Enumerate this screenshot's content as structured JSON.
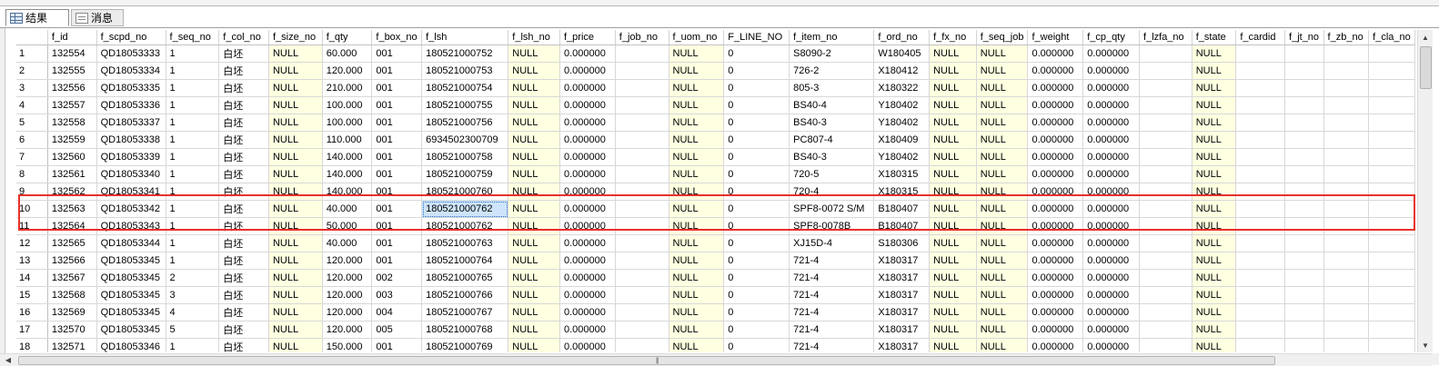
{
  "tabs": [
    {
      "label": "结果",
      "icon": "results-grid-icon",
      "active": true
    },
    {
      "label": "消息",
      "icon": "messages-icon",
      "active": false
    }
  ],
  "columns": [
    "f_id",
    "f_scpd_no",
    "f_seq_no",
    "f_col_no",
    "f_size_no",
    "f_qty",
    "f_box_no",
    "f_lsh",
    "f_lsh_no",
    "f_price",
    "f_job_no",
    "f_uom_no",
    "F_LINE_NO",
    "f_item_no",
    "f_ord_no",
    "f_fx_no",
    "f_seq_job",
    "f_weight",
    "f_cp_qty",
    "f_lzfa_no",
    "f_state",
    "f_cardid",
    "f_jt_no",
    "f_zb_no",
    "f_cla_no"
  ],
  "rows": [
    {
      "n": "1",
      "c": [
        "132554",
        "QD18053333",
        "1",
        "白坯",
        "NULL",
        "60.000",
        "001",
        "180521000752",
        "NULL",
        "0.000000",
        "",
        "NULL",
        "0",
        "S8090-2",
        "W180405",
        "NULL",
        "NULL",
        "0.000000",
        "0.000000",
        "",
        "NULL",
        "",
        "",
        "",
        ""
      ]
    },
    {
      "n": "2",
      "c": [
        "132555",
        "QD18053334",
        "1",
        "白坯",
        "NULL",
        "120.000",
        "001",
        "180521000753",
        "NULL",
        "0.000000",
        "",
        "NULL",
        "0",
        "726-2",
        "X180412",
        "NULL",
        "NULL",
        "0.000000",
        "0.000000",
        "",
        "NULL",
        "",
        "",
        "",
        ""
      ]
    },
    {
      "n": "3",
      "c": [
        "132556",
        "QD18053335",
        "1",
        "白坯",
        "NULL",
        "210.000",
        "001",
        "180521000754",
        "NULL",
        "0.000000",
        "",
        "NULL",
        "0",
        "805-3",
        "X180322",
        "NULL",
        "NULL",
        "0.000000",
        "0.000000",
        "",
        "NULL",
        "",
        "",
        "",
        ""
      ]
    },
    {
      "n": "4",
      "c": [
        "132557",
        "QD18053336",
        "1",
        "白坯",
        "NULL",
        "100.000",
        "001",
        "180521000755",
        "NULL",
        "0.000000",
        "",
        "NULL",
        "0",
        "BS40-4",
        "Y180402",
        "NULL",
        "NULL",
        "0.000000",
        "0.000000",
        "",
        "NULL",
        "",
        "",
        "",
        ""
      ]
    },
    {
      "n": "5",
      "c": [
        "132558",
        "QD18053337",
        "1",
        "白坯",
        "NULL",
        "100.000",
        "001",
        "180521000756",
        "NULL",
        "0.000000",
        "",
        "NULL",
        "0",
        "BS40-3",
        "Y180402",
        "NULL",
        "NULL",
        "0.000000",
        "0.000000",
        "",
        "NULL",
        "",
        "",
        "",
        ""
      ]
    },
    {
      "n": "6",
      "c": [
        "132559",
        "QD18053338",
        "1",
        "白坯",
        "NULL",
        "110.000",
        "001",
        "6934502300709",
        "NULL",
        "0.000000",
        "",
        "NULL",
        "0",
        "PC807-4",
        "X180409",
        "NULL",
        "NULL",
        "0.000000",
        "0.000000",
        "",
        "NULL",
        "",
        "",
        "",
        ""
      ]
    },
    {
      "n": "7",
      "c": [
        "132560",
        "QD18053339",
        "1",
        "白坯",
        "NULL",
        "140.000",
        "001",
        "180521000758",
        "NULL",
        "0.000000",
        "",
        "NULL",
        "0",
        "BS40-3",
        "Y180402",
        "NULL",
        "NULL",
        "0.000000",
        "0.000000",
        "",
        "NULL",
        "",
        "",
        "",
        ""
      ]
    },
    {
      "n": "8",
      "c": [
        "132561",
        "QD18053340",
        "1",
        "白坯",
        "NULL",
        "140.000",
        "001",
        "180521000759",
        "NULL",
        "0.000000",
        "",
        "NULL",
        "0",
        "720-5",
        "X180315",
        "NULL",
        "NULL",
        "0.000000",
        "0.000000",
        "",
        "NULL",
        "",
        "",
        "",
        ""
      ]
    },
    {
      "n": "9",
      "c": [
        "132562",
        "QD18053341",
        "1",
        "白坯",
        "NULL",
        "140.000",
        "001",
        "180521000760",
        "NULL",
        "0.000000",
        "",
        "NULL",
        "0",
        "720-4",
        "X180315",
        "NULL",
        "NULL",
        "0.000000",
        "0.000000",
        "",
        "NULL",
        "",
        "",
        "",
        ""
      ]
    },
    {
      "n": "10",
      "c": [
        "132563",
        "QD18053342",
        "1",
        "白坯",
        "NULL",
        "40.000",
        "001",
        "180521000762",
        "NULL",
        "0.000000",
        "",
        "NULL",
        "0",
        "SPF8-0072 S/M",
        "B180407",
        "NULL",
        "NULL",
        "0.000000",
        "0.000000",
        "",
        "NULL",
        "",
        "",
        "",
        ""
      ]
    },
    {
      "n": "11",
      "c": [
        "132564",
        "QD18053343",
        "1",
        "白坯",
        "NULL",
        "50.000",
        "001",
        "180521000762",
        "NULL",
        "0.000000",
        "",
        "NULL",
        "0",
        "SPF8-0078B",
        "B180407",
        "NULL",
        "NULL",
        "0.000000",
        "0.000000",
        "",
        "NULL",
        "",
        "",
        "",
        ""
      ]
    },
    {
      "n": "12",
      "c": [
        "132565",
        "QD18053344",
        "1",
        "白坯",
        "NULL",
        "40.000",
        "001",
        "180521000763",
        "NULL",
        "0.000000",
        "",
        "NULL",
        "0",
        "XJ15D-4",
        "S180306",
        "NULL",
        "NULL",
        "0.000000",
        "0.000000",
        "",
        "NULL",
        "",
        "",
        "",
        ""
      ]
    },
    {
      "n": "13",
      "c": [
        "132566",
        "QD18053345",
        "1",
        "白坯",
        "NULL",
        "120.000",
        "001",
        "180521000764",
        "NULL",
        "0.000000",
        "",
        "NULL",
        "0",
        "721-4",
        "X180317",
        "NULL",
        "NULL",
        "0.000000",
        "0.000000",
        "",
        "NULL",
        "",
        "",
        "",
        ""
      ]
    },
    {
      "n": "14",
      "c": [
        "132567",
        "QD18053345",
        "2",
        "白坯",
        "NULL",
        "120.000",
        "002",
        "180521000765",
        "NULL",
        "0.000000",
        "",
        "NULL",
        "0",
        "721-4",
        "X180317",
        "NULL",
        "NULL",
        "0.000000",
        "0.000000",
        "",
        "NULL",
        "",
        "",
        "",
        ""
      ]
    },
    {
      "n": "15",
      "c": [
        "132568",
        "QD18053345",
        "3",
        "白坯",
        "NULL",
        "120.000",
        "003",
        "180521000766",
        "NULL",
        "0.000000",
        "",
        "NULL",
        "0",
        "721-4",
        "X180317",
        "NULL",
        "NULL",
        "0.000000",
        "0.000000",
        "",
        "NULL",
        "",
        "",
        "",
        ""
      ]
    },
    {
      "n": "16",
      "c": [
        "132569",
        "QD18053345",
        "4",
        "白坯",
        "NULL",
        "120.000",
        "004",
        "180521000767",
        "NULL",
        "0.000000",
        "",
        "NULL",
        "0",
        "721-4",
        "X180317",
        "NULL",
        "NULL",
        "0.000000",
        "0.000000",
        "",
        "NULL",
        "",
        "",
        "",
        ""
      ]
    },
    {
      "n": "17",
      "c": [
        "132570",
        "QD18053345",
        "5",
        "白坯",
        "NULL",
        "120.000",
        "005",
        "180521000768",
        "NULL",
        "0.000000",
        "",
        "NULL",
        "0",
        "721-4",
        "X180317",
        "NULL",
        "NULL",
        "0.000000",
        "0.000000",
        "",
        "NULL",
        "",
        "",
        "",
        ""
      ]
    },
    {
      "n": "18",
      "c": [
        "132571",
        "QD18053346",
        "1",
        "白坯",
        "NULL",
        "150.000",
        "001",
        "180521000769",
        "NULL",
        "0.000000",
        "",
        "NULL",
        "0",
        "721-4",
        "X180317",
        "NULL",
        "NULL",
        "0.000000",
        "0.000000",
        "",
        "NULL",
        "",
        "",
        "",
        ""
      ]
    }
  ],
  "selected_cell": {
    "row": "10",
    "column": "f_lsh"
  },
  "highlighted_rows": [
    "10",
    "11"
  ],
  "colors": {
    "null_cell": "#ffffe1",
    "selected_cell": "#cde4fa",
    "highlight_border": "#e8302a"
  }
}
